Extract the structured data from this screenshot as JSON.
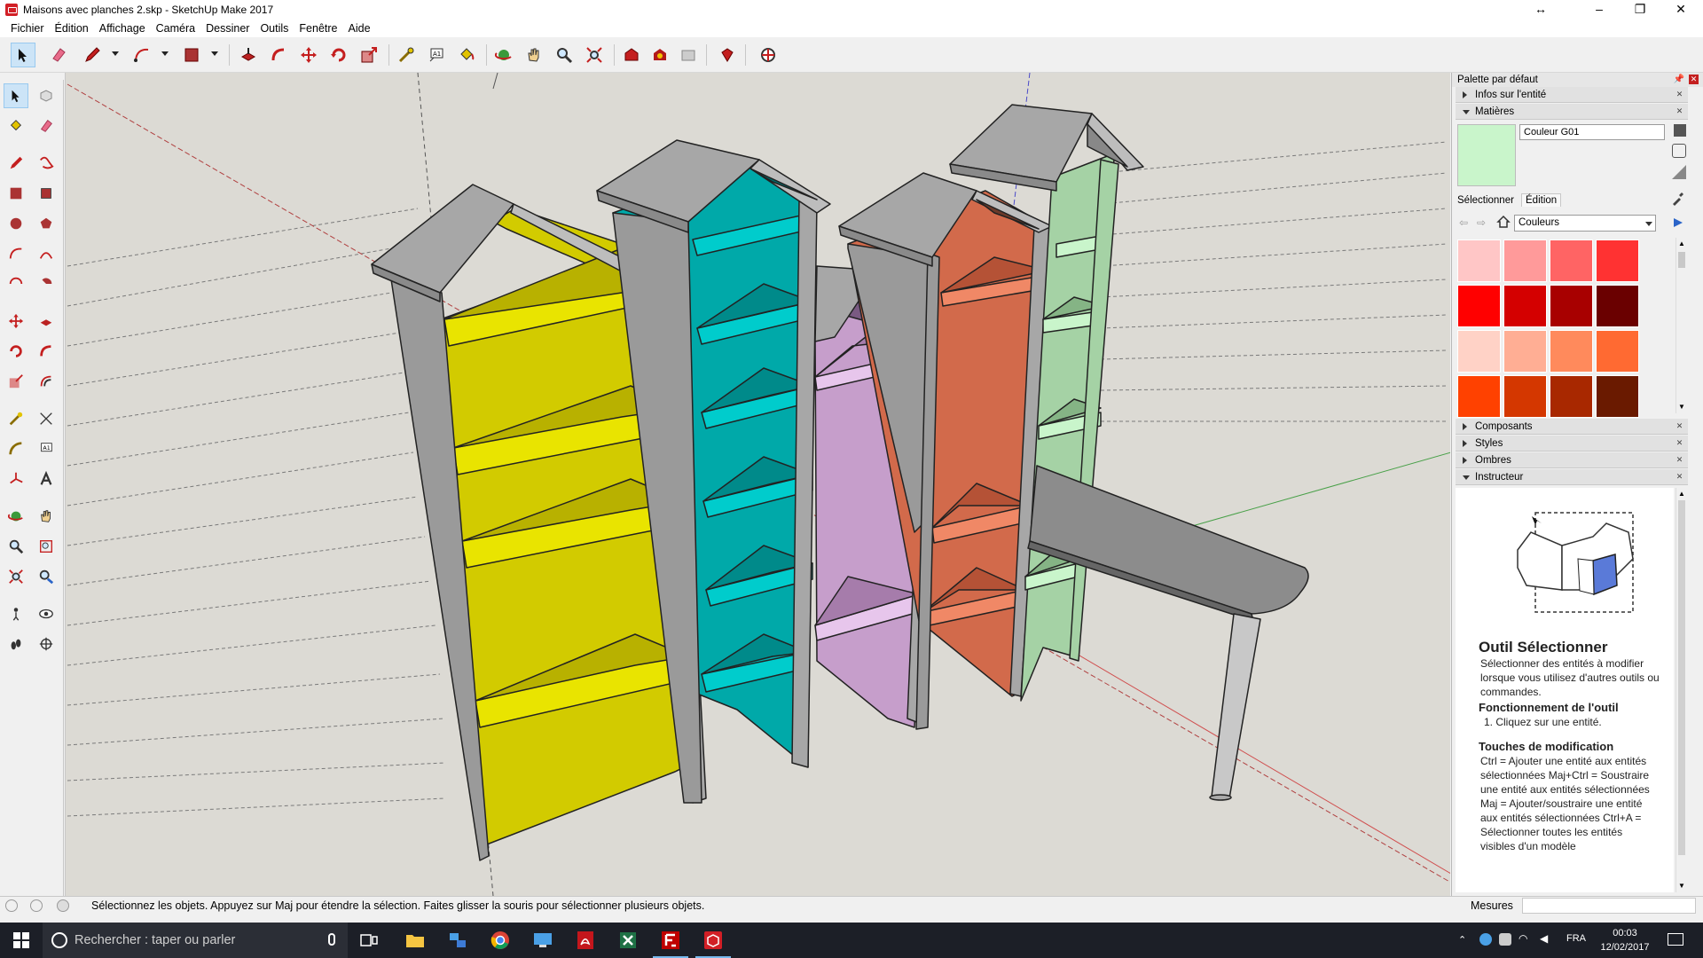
{
  "window": {
    "title": "Maisons avec planches 2.skp - SketchUp Make 2017",
    "controls": [
      "↔",
      "–",
      "❐",
      "✕"
    ]
  },
  "menu": [
    "Fichier",
    "Édition",
    "Affichage",
    "Caméra",
    "Dessiner",
    "Outils",
    "Fenêtre",
    "Aide"
  ],
  "toolbar_icons": [
    "select-icon",
    "eraser-icon",
    "pencil-icon",
    "arc-icon",
    "rectangle-icon",
    "push-pull-icon",
    "follow-me-icon",
    "move-icon",
    "rotate-icon",
    "scale-icon",
    "tape-measure-icon",
    "text-icon",
    "paint-bucket-icon",
    "orbit-icon",
    "pan-icon",
    "zoom-icon",
    "zoom-extents-icon",
    "warehouse-icon",
    "extension-warehouse-icon",
    "share-model-icon",
    "ruby-icon",
    "layout-icon"
  ],
  "tray": {
    "title": "Palette par défaut",
    "sections_top": [
      {
        "label": "Infos sur l'entité",
        "expanded": false
      },
      {
        "label": "Matières",
        "expanded": true
      }
    ],
    "material": {
      "name": "Couleur G01",
      "preview_color": "#c9f5cb",
      "tab_select": "Sélectionner",
      "tab_edit": "Édition",
      "library": "Couleurs",
      "swatches": [
        "#ffc6c6",
        "#ff9a9a",
        "#ff6464",
        "#ff3232",
        "#ff0000",
        "#d40000",
        "#a80000",
        "#6a0000",
        "#ffd2c6",
        "#ffae94",
        "#ff8a5c",
        "#ff6a32",
        "#ff4100",
        "#d43700",
        "#a82800",
        "#6a1a00"
      ]
    },
    "sections_bottom": [
      {
        "label": "Composants",
        "expanded": false
      },
      {
        "label": "Styles",
        "expanded": false
      },
      {
        "label": "Ombres",
        "expanded": false
      },
      {
        "label": "Instructeur",
        "expanded": true
      }
    ],
    "instructor": {
      "title": "Outil Sélectionner",
      "intro": "Sélectionner des entités à modifier lorsque vous utilisez d'autres outils ou commandes.",
      "h_operation": "Fonctionnement de l'outil",
      "step1": "1. Cliquez sur une entité.",
      "h_modifiers": "Touches de modification",
      "modifiers": "Ctrl = Ajouter une entité aux entités sélectionnées Maj+Ctrl = Soustraire une entité aux entités sélectionnées Maj = Ajouter/soustraire une entité aux entités sélectionnées Ctrl+A = Sélectionner toutes les entités visibles d'un modèle"
    }
  },
  "model": {
    "shelf_colors": {
      "yellow": "#d2cb00",
      "cyan": "#00a9a9",
      "purple": "#c69ecb",
      "orange": "#d26a4b",
      "green": "#a5d2a5",
      "roof": "#a7a7a7",
      "side": "#9a9a9a"
    }
  },
  "status": {
    "text": "Sélectionnez les objets. Appuyez sur Maj pour étendre la sélection. Faites glisser la souris pour sélectionner plusieurs objets.",
    "measures_label": "Mesures",
    "measures_value": ""
  },
  "taskbar": {
    "search_placeholder": "Rechercher : taper ou parler",
    "language": "FRA",
    "time": "00:03",
    "date": "12/02/2017",
    "apps": [
      "task-view-icon",
      "file-explorer-icon",
      "network-icon",
      "chrome-icon",
      "remote-desktop-icon",
      "acrobat-icon",
      "excel-icon",
      "filezilla-icon",
      "sketchup-icon"
    ]
  }
}
